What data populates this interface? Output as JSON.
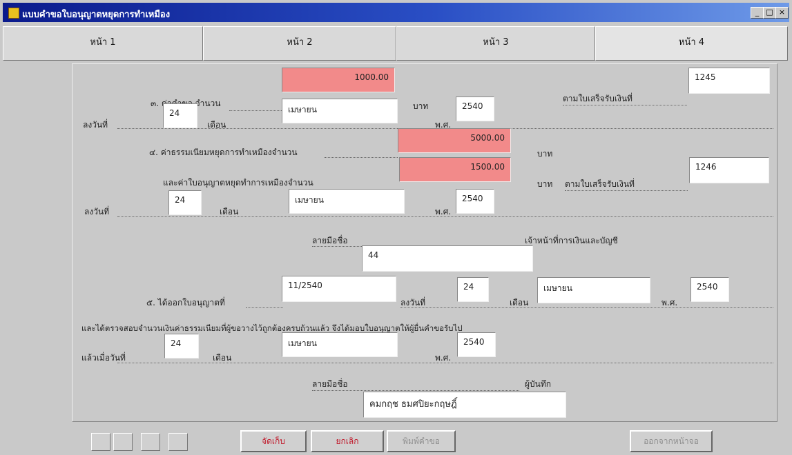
{
  "window": {
    "title": "แบบคำขอใบอนุญาตหยุดการทำเหมือง",
    "controls": [
      "_",
      "□",
      "×"
    ]
  },
  "tabs": [
    "หน้า 1",
    "หน้า 2",
    "หน้า 3",
    "หน้า 4"
  ],
  "active_tab": "หน้า 4",
  "section3": {
    "fee_label": "๓. ค่าคำขอ จำนวน",
    "fee_value": "1000.00",
    "baht": "บาท",
    "receipt_label": "ตามใบเสร็จรับเงินที่",
    "receipt_no": "1245",
    "date_label": "ลงวันที่",
    "day": "24",
    "month_label": "เดือน",
    "month": "เมษายน",
    "year_label": "พ.ศ.",
    "year": "2540"
  },
  "section4": {
    "reg_label": "๔. ค่าธรรมเนียมหยุดการทำเหมืองจำนวน",
    "reg_value": "5000.00",
    "baht1": "บาท",
    "permit_label": "และค่าใบอนุญาตหยุดทำการเหมืองจำนวน",
    "permit_value": "1500.00",
    "baht2": "บาท",
    "receipt_label": "ตามใบเสร็จรับเงินที่",
    "receipt_no": "1246",
    "date_label": "ลงวันที่",
    "day": "24",
    "month_label": "เดือน",
    "month": "เมษายน",
    "year_label": "พ.ศ.",
    "year": "2540",
    "signature_label": "ลายมือชื่อ",
    "signature_value": "44",
    "officer_label": "เจ้าหน้าที่การเงินและบัญชี"
  },
  "section5": {
    "issued_label": "๕. ได้ออกใบอนุญาตที่",
    "permit_no": "11/2540",
    "date_label": "ลงวันที่",
    "day": "24",
    "month_label": "เดือน",
    "month": "เมษายน",
    "year_label": "พ.ศ.",
    "year": "2540",
    "statement": "และได้ตรวจสอบจำนวนเงินค่าธรรมเนียมที่ผู้ขอวางไว้ถูกต้องครบถ้วนแล้ว จึงได้มอบใบอนุญาตให้ผู้ยื่นคำขอรับไป",
    "since_label": "แล้วเมื่อวันที่",
    "since_day": "24",
    "since_month_label": "เดือน",
    "since_month": "เมษายน",
    "since_year_label": "พ.ศ.",
    "since_year": "2540",
    "signature_label": "ลายมือชื่อ",
    "signature_value": "คมกฤช ธมศปิยะกฤษฎิ์",
    "recorder_label": "ผู้บันทึก"
  },
  "buttons": {
    "save": "จัดเก็บ",
    "cancel": "ยกเลิก",
    "print": "พิมพ์คำขอ",
    "exit": "ออกจากหน้าจอ"
  },
  "colors": {
    "highlight": "#f28a8a",
    "title_bar": "#0a1a8c",
    "button_text_red": "#c0182a"
  }
}
